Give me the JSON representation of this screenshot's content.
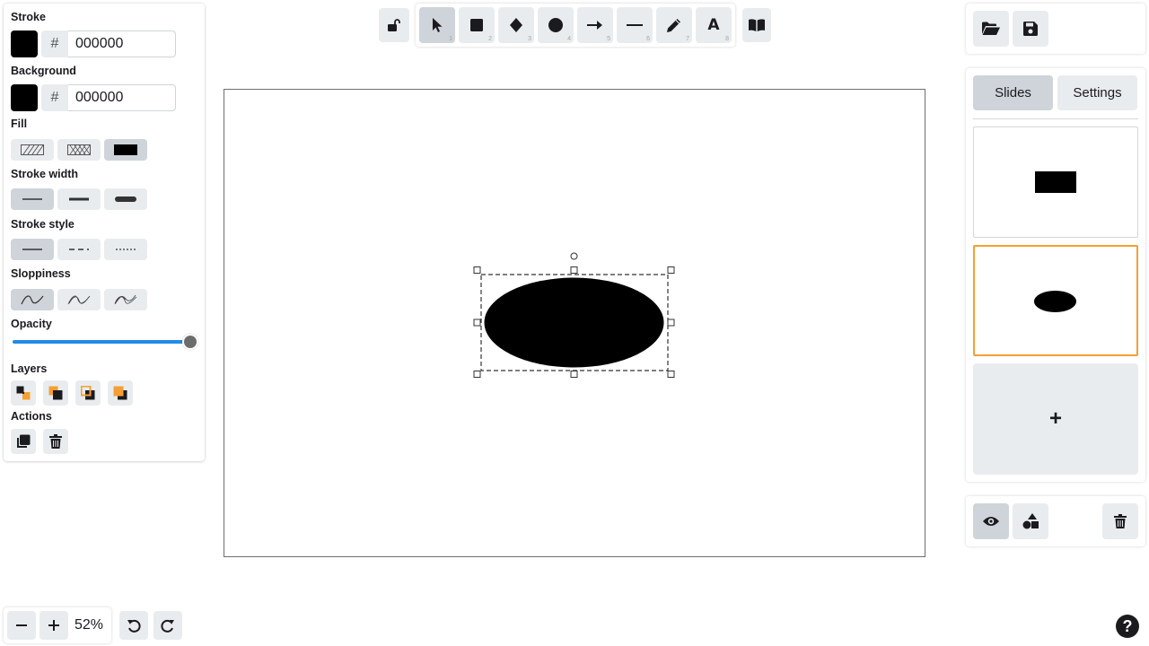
{
  "properties": {
    "stroke": {
      "label": "Stroke",
      "hash": "#",
      "hex": "000000",
      "color": "#000000"
    },
    "background": {
      "label": "Background",
      "hash": "#",
      "hex": "000000",
      "color": "#000000"
    },
    "fill": {
      "label": "Fill",
      "options": [
        "hachure",
        "cross-hatch",
        "solid"
      ],
      "selected": "solid"
    },
    "stroke_width": {
      "label": "Stroke width",
      "options": [
        "thin",
        "bold",
        "extra-bold"
      ],
      "selected": "thin"
    },
    "stroke_style": {
      "label": "Stroke style",
      "options": [
        "solid",
        "dashed",
        "dotted"
      ],
      "selected": "solid"
    },
    "sloppiness": {
      "label": "Sloppiness",
      "options": [
        "architect",
        "artist",
        "cartoonist"
      ],
      "selected": "architect"
    },
    "opacity": {
      "label": "Opacity",
      "value": 100
    },
    "layers": {
      "label": "Layers",
      "buttons": [
        "send-to-back",
        "send-backward",
        "bring-forward",
        "bring-to-front"
      ]
    },
    "actions": {
      "label": "Actions",
      "buttons": [
        "duplicate",
        "delete"
      ]
    }
  },
  "toolbar": {
    "lock": "unlocked-lock-icon",
    "tools": [
      {
        "name": "selection",
        "icon": "pointer-icon",
        "key": "1",
        "active": true
      },
      {
        "name": "rectangle",
        "icon": "rectangle-icon",
        "key": "2"
      },
      {
        "name": "diamond",
        "icon": "diamond-icon",
        "key": "3"
      },
      {
        "name": "ellipse",
        "icon": "ellipse-icon",
        "key": "4"
      },
      {
        "name": "arrow",
        "icon": "arrow-icon",
        "key": "5"
      },
      {
        "name": "line",
        "icon": "line-icon",
        "key": "6"
      },
      {
        "name": "draw",
        "icon": "pencil-icon",
        "key": "7"
      },
      {
        "name": "text",
        "icon": "text-icon",
        "key": "8",
        "glyph": "A"
      }
    ],
    "library": "book-icon"
  },
  "canvas": {
    "selected_shape": "ellipse",
    "shape_color": "#000000"
  },
  "slides_panel": {
    "tabs": [
      "Slides",
      "Settings"
    ],
    "active_tab": "Slides",
    "slides": [
      {
        "shape": "rectangle",
        "selected": false
      },
      {
        "shape": "ellipse",
        "selected": true
      }
    ],
    "add_label": "+"
  },
  "zoom": {
    "value": "52%",
    "minus": "−",
    "plus": "+"
  },
  "help": "?",
  "accent_color": "#f59f33",
  "slider_color": "#228be6"
}
